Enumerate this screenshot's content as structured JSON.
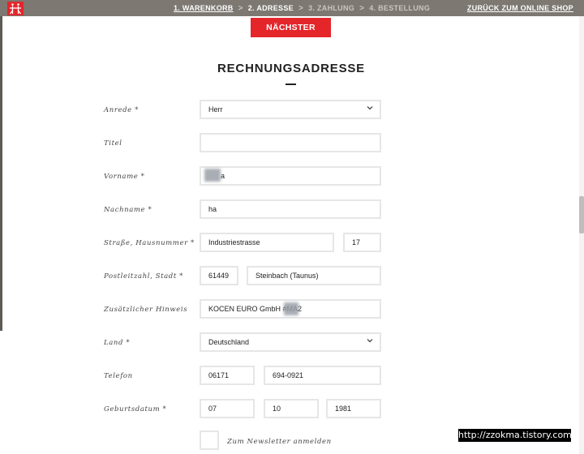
{
  "header": {
    "logo_icon": "twin-figures-logo",
    "steps": [
      {
        "label": "1. WARENKORB",
        "state": "done"
      },
      {
        "label": "2. ADRESSE",
        "state": "active"
      },
      {
        "label": "3. ZAHLUNG",
        "state": "upcoming"
      },
      {
        "label": "4. BESTELLUNG",
        "state": "upcoming"
      }
    ],
    "separator": ">",
    "back_link": "ZURÜCK ZUM ONLINE SHOP"
  },
  "next_button": "NÄCHSTER SCHRITT",
  "heading": "RECHNUNGSADRESSE",
  "form": {
    "salutation": {
      "label": "Anrede *",
      "value": "Herr"
    },
    "title": {
      "label": "Titel",
      "value": ""
    },
    "first_name": {
      "label": "Vorname *",
      "value": "a"
    },
    "last_name": {
      "label": "Nachname *",
      "value": "ha"
    },
    "street": {
      "label": "Straße, Hausnummer *",
      "value": "Industriestrasse",
      "number": "17"
    },
    "city": {
      "label": "Postleitzahl, Stadt *",
      "zip": "61449",
      "value": "Steinbach (Taunus)"
    },
    "additional": {
      "label": "Zusätzlicher Hinweis",
      "value": "KOCEN EURO GmbH #MA2"
    },
    "country": {
      "label": "Land *",
      "value": "Deutschland"
    },
    "phone": {
      "label": "Telefon",
      "prefix": "06171",
      "number": "694-0921"
    },
    "birthdate": {
      "label": "Geburtsdatum *",
      "day": "07",
      "month": "10",
      "year": "1981"
    },
    "newsletter": {
      "label": "Zum Newsletter anmelden",
      "checked": false
    }
  },
  "watermark": "http://zzokma.tistory.com",
  "colors": {
    "topbar": "#7d7872",
    "accent": "#e4262b",
    "field_border": "#e6e6e6"
  }
}
